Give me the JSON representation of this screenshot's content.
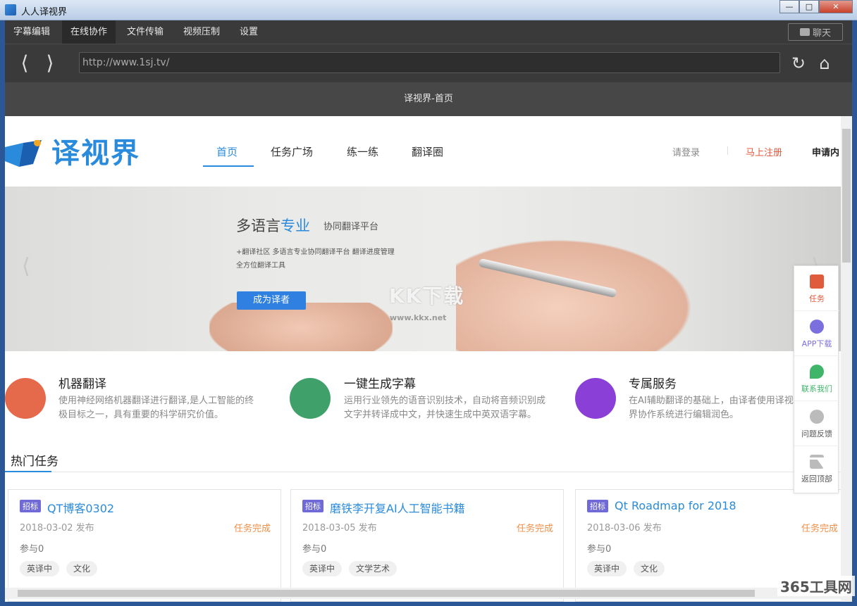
{
  "window": {
    "title": "人人译视界"
  },
  "menu": {
    "items": [
      "字幕编辑",
      "在线协作",
      "文件传输",
      "视频压制",
      "设置"
    ],
    "chat_label": "聊天"
  },
  "toolbar": {
    "url": "http://www.1sj.tv/"
  },
  "page_title": "译视界-首页",
  "site": {
    "logo_text": "译视界",
    "nav": [
      "首页",
      "任务广场",
      "练一练",
      "翻译圈"
    ],
    "login": "请登录",
    "register": "马上注册",
    "apply": "申请内"
  },
  "banner": {
    "title_prefix": "多语言",
    "title_highlight": "专业",
    "subtitle": "协同翻译平台",
    "tags_line1": "+翻译社区   多语言专业协同翻译平台   翻译进度管理",
    "tags_line2": "全方位翻译工具",
    "button": "成为译者",
    "watermark": "KK下载",
    "watermark_url": "www.kkx.net"
  },
  "features": [
    {
      "title": "机器翻译",
      "desc": "使用神经网络机器翻译进行翻译,是人工智能的终极目标之一，具有重要的科学研究价值。",
      "color": "#e56a4c"
    },
    {
      "title": "一键生成字幕",
      "desc": "运用行业领先的语音识别技术，自动将音频识别成文字并转译成中文，并快速生成中英双语字幕。",
      "color": "#3fa06a"
    },
    {
      "title": "专属服务",
      "desc": "在AI辅助翻译的基础上，由译者使用译视界协作系统进行编辑润色。",
      "color": "#8a3fd6"
    }
  ],
  "hot_tasks": {
    "title": "热门任务",
    "cards": [
      {
        "tag": "招标",
        "title": "QT博客0302",
        "date": "2018-03-02 发布",
        "status": "任务完成",
        "join": "参与0",
        "labels": [
          "英译中",
          "文化"
        ]
      },
      {
        "tag": "招标",
        "title": "磨铁李开复AI人工智能书籍",
        "date": "2018-03-05 发布",
        "status": "任务完成",
        "join": "参与0",
        "labels": [
          "英译中",
          "文学艺术"
        ]
      },
      {
        "tag": "招标",
        "title": "Qt Roadmap for 2018",
        "date": "2018-03-06 发布",
        "status": "任务完成",
        "join": "参与0",
        "labels": [
          "英译中",
          "文化"
        ]
      }
    ]
  },
  "float_bar": [
    {
      "label": "任务",
      "color": "#e05a3c"
    },
    {
      "label": "APP下载",
      "color": "#7b6fe0"
    },
    {
      "label": "联系我们",
      "color": "#3fb56a"
    },
    {
      "label": "问题反馈",
      "color": "#9a9a9a"
    },
    {
      "label": "返回顶部",
      "color": "#9a9a9a"
    }
  ],
  "corner_mark": "365工具网"
}
